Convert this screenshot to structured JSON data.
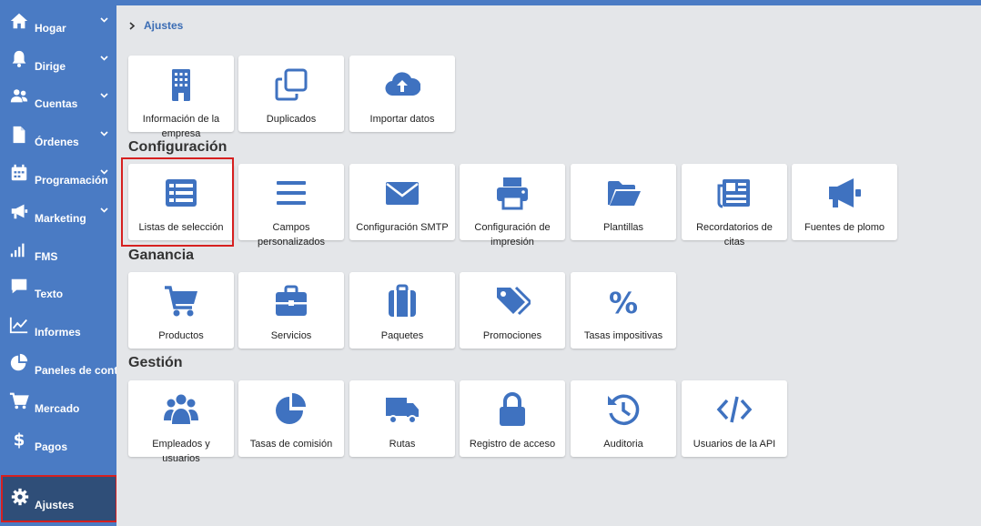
{
  "sidebar": {
    "items": [
      {
        "label": "Hogar",
        "icon": "home-icon",
        "chevron": true
      },
      {
        "label": "Dirige",
        "icon": "bell-icon",
        "chevron": true
      },
      {
        "label": "Cuentas",
        "icon": "users-icon",
        "chevron": true
      },
      {
        "label": "Órdenes",
        "icon": "file-icon",
        "chevron": true
      },
      {
        "label": "Programación",
        "icon": "calendar-icon",
        "chevron": true
      },
      {
        "label": "Marketing",
        "icon": "bullhorn-icon",
        "chevron": true
      },
      {
        "label": "FMS",
        "icon": "signal-icon",
        "chevron": false
      },
      {
        "label": "Texto",
        "icon": "comment-icon",
        "chevron": false
      },
      {
        "label": "Informes",
        "icon": "line-chart-icon",
        "chevron": false
      },
      {
        "label": "Paneles de control",
        "icon": "pie-chart-icon",
        "chevron": false
      },
      {
        "label": "Mercado",
        "icon": "cart-icon",
        "chevron": false
      },
      {
        "label": "Pagos",
        "icon": "dollar-icon",
        "chevron": false
      }
    ],
    "active": {
      "label": "Ajustes",
      "icon": "gear-icon"
    }
  },
  "breadcrumb": {
    "current": "Ajustes"
  },
  "top_tiles": [
    {
      "label": "Información de la empresa",
      "icon": "building-icon"
    },
    {
      "label": "Duplicados",
      "icon": "clone-icon"
    },
    {
      "label": "Importar datos",
      "icon": "cloud-upload-icon"
    }
  ],
  "sections": [
    {
      "title": "Configuración",
      "tiles": [
        {
          "label": "Listas de selección",
          "icon": "list-icon"
        },
        {
          "label": "Campos personalizados",
          "icon": "bars-icon"
        },
        {
          "label": "Configuración SMTP",
          "icon": "envelope-icon"
        },
        {
          "label": "Configuración de impresión",
          "icon": "printer-icon"
        },
        {
          "label": "Plantillas",
          "icon": "folder-icon"
        },
        {
          "label": "Recordatorios de citas",
          "icon": "newspaper-icon"
        },
        {
          "label": "Fuentes de plomo",
          "icon": "megaphone-icon"
        }
      ]
    },
    {
      "title": "Ganancia",
      "tiles": [
        {
          "label": "Productos",
          "icon": "cart-icon"
        },
        {
          "label": "Servicios",
          "icon": "briefcase-icon"
        },
        {
          "label": "Paquetes",
          "icon": "suitcase-icon"
        },
        {
          "label": "Promociones",
          "icon": "tags-icon"
        },
        {
          "label": "Tasas impositivas",
          "icon": "percent-icon"
        }
      ]
    },
    {
      "title": "Gestión",
      "tiles": [
        {
          "label": "Empleados y usuarios",
          "icon": "users-icon"
        },
        {
          "label": "Tasas de comisión",
          "icon": "pie-chart-icon"
        },
        {
          "label": "Rutas",
          "icon": "truck-icon"
        },
        {
          "label": "Registro de acceso",
          "icon": "lock-icon"
        },
        {
          "label": "Auditoria",
          "icon": "history-icon"
        },
        {
          "label": "Usuarios de la API",
          "icon": "code-icon"
        }
      ]
    }
  ],
  "colors": {
    "accent": "#4a7bc4",
    "icon": "#3f72c0",
    "active": "#2f4e78",
    "highlight": "#d62020",
    "background": "#e4e6e9"
  }
}
